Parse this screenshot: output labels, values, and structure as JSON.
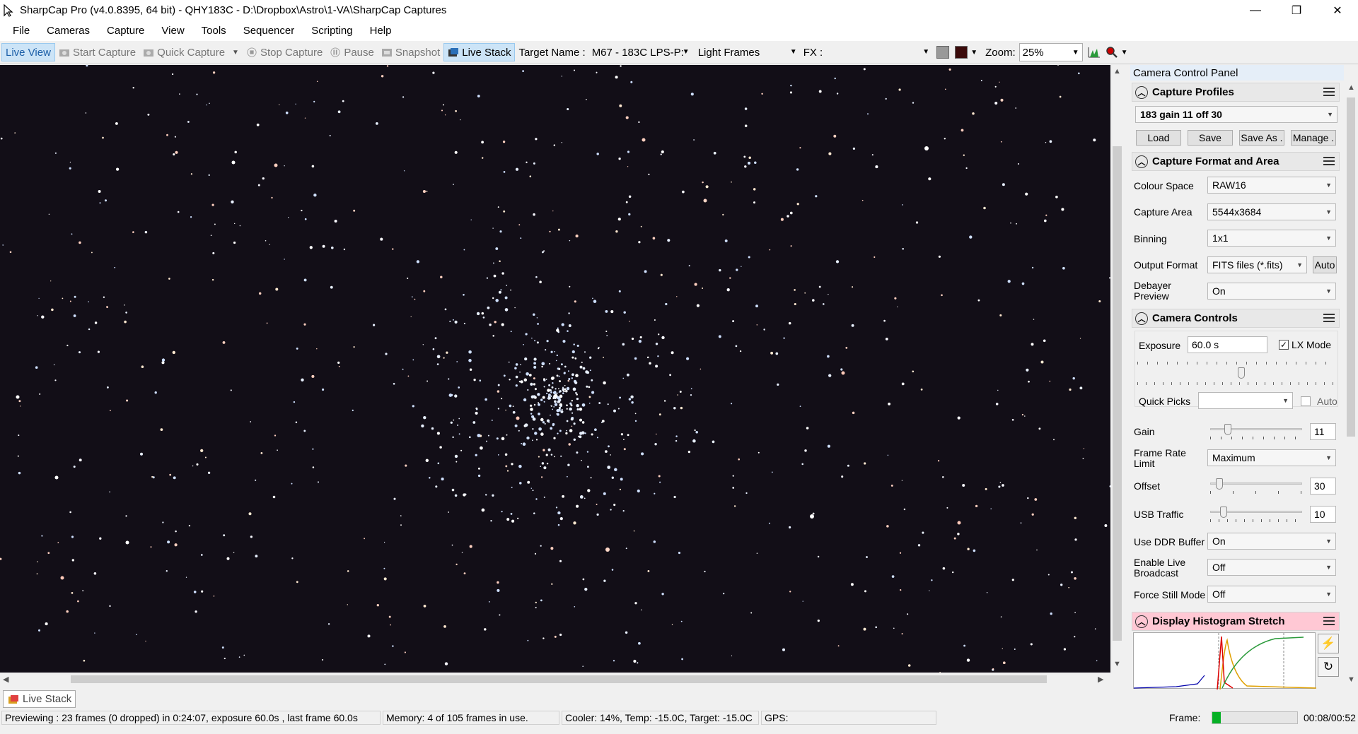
{
  "window": {
    "title": "SharpCap Pro (v4.0.8395, 64 bit) - QHY183C - D:\\Dropbox\\Astro\\1-VA\\SharpCap Captures",
    "minimize": "—",
    "maximize": "❐",
    "close": "✕"
  },
  "menu": [
    "File",
    "Cameras",
    "Capture",
    "View",
    "Tools",
    "Sequencer",
    "Scripting",
    "Help"
  ],
  "toolbar": {
    "live_view": "Live View",
    "start_capture": "Start Capture",
    "quick_capture": "Quick Capture",
    "stop_capture": "Stop Capture",
    "pause": "Pause",
    "snapshot": "Snapshot",
    "live_stack": "Live Stack",
    "target_name_label": "Target Name :",
    "target_name_value": "M67 - 183C LPS-P:",
    "frame_type": "Light Frames",
    "fx_label": "FX :",
    "fx_value": "",
    "zoom_label": "Zoom:",
    "zoom_value": "25%"
  },
  "doc_tab": "Live Stack",
  "panel": {
    "title": "Camera Control Panel",
    "capture_profiles": {
      "header": "Capture Profiles",
      "selected": "183 gain 11 off 30",
      "load": "Load",
      "save": "Save",
      "save_as": "Save As .",
      "manage": "Manage ."
    },
    "capture_format": {
      "header": "Capture Format and Area",
      "colour_space_label": "Colour Space",
      "colour_space": "RAW16",
      "capture_area_label": "Capture Area",
      "capture_area": "5544x3684",
      "binning_label": "Binning",
      "binning": "1x1",
      "output_format_label": "Output Format",
      "output_format": "FITS files (*.fits)",
      "auto": "Auto",
      "debayer_label_1": "Debayer",
      "debayer_label_2": "Preview",
      "debayer": "On"
    },
    "camera_controls": {
      "header": "Camera Controls",
      "exposure_label": "Exposure",
      "exposure": "60.0 s",
      "lx_mode": "LX Mode",
      "lx_mode_checked": true,
      "quick_picks_label": "Quick Picks",
      "quick_picks": "",
      "quick_auto": "Auto",
      "gain_label": "Gain",
      "gain": "11",
      "frame_rate_label_1": "Frame Rate",
      "frame_rate_label_2": "Limit",
      "frame_rate": "Maximum",
      "offset_label": "Offset",
      "offset": "30",
      "usb_label": "USB Traffic",
      "usb": "10",
      "ddr_label": "Use DDR Buffer",
      "ddr": "On",
      "broadcast_label_1": "Enable Live",
      "broadcast_label_2": "Broadcast",
      "broadcast": "Off",
      "still_label": "Force Still Mode",
      "still": "Off"
    },
    "histogram": {
      "header": "Display Histogram Stretch"
    }
  },
  "status": {
    "preview": "Previewing : 23 frames (0 dropped) in 0:24:07, exposure 60.0s , last frame 60.0s",
    "memory": "Memory: 4 of 105 frames in use.",
    "cooler": "Cooler: 14%, Temp: -15.0C, Target: -15.0C",
    "gps": "GPS:",
    "frame_label": "Frame:",
    "frame_progress": 0.1,
    "frame_time": "00:08/00:52"
  },
  "colors": {
    "sky": "#120e17",
    "histogram_header": "#ffc8d4",
    "selected_tool": "#cce4f7"
  }
}
